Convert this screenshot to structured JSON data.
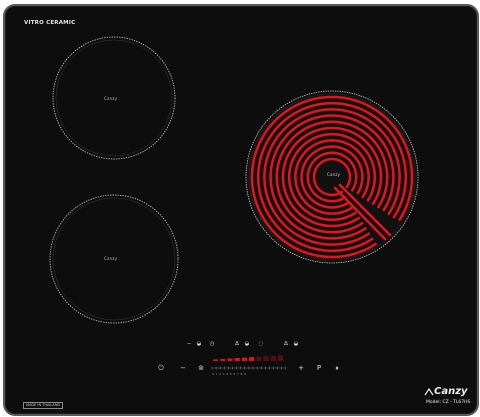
{
  "hob": {
    "brand_top_left": "VITRO CERAMIC",
    "made_in_label": "MADE IN THAILAND",
    "logo": {
      "name": "Canzy",
      "model": "Model: CZ - TL67HS"
    },
    "zone_label_front_left": "Canzy",
    "zone_label_rear_left": "Canzy",
    "zone_label_right": "Canzy",
    "heat_color": "#e0141f",
    "glass_color": "#0d0d0d",
    "frame_color": "#5a5a5a"
  },
  "controls": {
    "top_row": [
      {
        "icon": "timer-minus-icon",
        "glyph": "−"
      },
      {
        "icon": "zone-indicator-icon",
        "glyph": "◒"
      },
      {
        "icon": "timer-icon",
        "glyph": "◷"
      },
      {
        "icon": "zone-select-icon",
        "glyph": "∆"
      },
      {
        "icon": "zone-indicator-icon",
        "glyph": "◒"
      },
      {
        "icon": "timer-plus-icon",
        "glyph": "◌"
      },
      {
        "icon": "zone-select-icon",
        "glyph": "∆"
      },
      {
        "icon": "zone-indicator-icon",
        "glyph": "◒"
      }
    ],
    "bottom_row": [
      {
        "icon": "power-icon",
        "glyph": "⏻"
      },
      {
        "icon": "minus-icon",
        "glyph": "−"
      },
      {
        "icon": "lock-icon",
        "glyph": "⊚"
      },
      {
        "icon": "plus-icon",
        "glyph": "+"
      },
      {
        "icon": "boost-icon",
        "glyph": "P"
      },
      {
        "icon": "pause-icon",
        "glyph": "⏸"
      }
    ],
    "power_slider_level": 0.55,
    "power_slider_scale": "0 1 2 3 4 5 6 7 8 9"
  }
}
